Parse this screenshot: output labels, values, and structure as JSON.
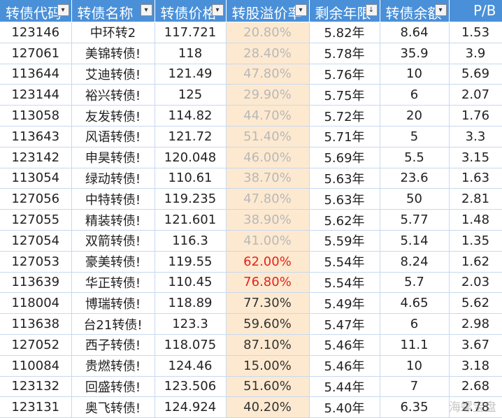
{
  "columns": [
    {
      "label": "转债代码",
      "filter": "dropdown"
    },
    {
      "label": "转债名称",
      "filter": "dropdown"
    },
    {
      "label": "转债价格",
      "filter": "filter-active"
    },
    {
      "label": "转股溢价率",
      "filter": "dropdown"
    },
    {
      "label": "剩余年限",
      "filter": "sorted-desc"
    },
    {
      "label": "转债余额",
      "filter": "dropdown"
    },
    {
      "label": "P/B",
      "filter": "dropdown"
    }
  ],
  "colors": {
    "header_bg": "#4a90d9",
    "premium_bg": "#fde9d0",
    "premium_faded": "#b8b8b8",
    "premium_highlight": "#e8201a",
    "premium_normal": "#333333"
  },
  "rows": [
    {
      "code": "123146",
      "name": "中环转2",
      "price": "117.721",
      "premium": "20.80%",
      "premium_style": "faded",
      "years": "5.82年",
      "balance": "8.64",
      "pb": "1.53"
    },
    {
      "code": "127061",
      "name": "美锦转债!",
      "price": "118",
      "premium": "28.40%",
      "premium_style": "faded",
      "years": "5.78年",
      "balance": "35.9",
      "pb": "3.9"
    },
    {
      "code": "113644",
      "name": "艾迪转债!",
      "price": "121.49",
      "premium": "47.80%",
      "premium_style": "faded",
      "years": "5.76年",
      "balance": "10",
      "pb": "5.69"
    },
    {
      "code": "123144",
      "name": "裕兴转债!",
      "price": "125",
      "premium": "29.90%",
      "premium_style": "faded",
      "years": "5.75年",
      "balance": "6",
      "pb": "2.07"
    },
    {
      "code": "113058",
      "name": "友发转债!",
      "price": "114.82",
      "premium": "44.70%",
      "premium_style": "faded",
      "years": "5.72年",
      "balance": "20",
      "pb": "1.76"
    },
    {
      "code": "113643",
      "name": "风语转债!",
      "price": "121.72",
      "premium": "51.40%",
      "premium_style": "faded",
      "years": "5.71年",
      "balance": "5",
      "pb": "3.3"
    },
    {
      "code": "123142",
      "name": "申昊转债!",
      "price": "120.048",
      "premium": "46.00%",
      "premium_style": "faded",
      "years": "5.69年",
      "balance": "5.5",
      "pb": "3.15"
    },
    {
      "code": "113054",
      "name": "绿动转债!",
      "price": "110.61",
      "premium": "38.70%",
      "premium_style": "faded",
      "years": "5.63年",
      "balance": "23.6",
      "pb": "1.63"
    },
    {
      "code": "127056",
      "name": "中特转债!",
      "price": "119.235",
      "premium": "47.80%",
      "premium_style": "faded",
      "years": "5.63年",
      "balance": "50",
      "pb": "2.81"
    },
    {
      "code": "127055",
      "name": "精装转债!",
      "price": "121.601",
      "premium": "38.90%",
      "premium_style": "faded",
      "years": "5.62年",
      "balance": "5.77",
      "pb": "1.48"
    },
    {
      "code": "127054",
      "name": "双箭转债!",
      "price": "116.3",
      "premium": "41.00%",
      "premium_style": "faded",
      "years": "5.59年",
      "balance": "5.14",
      "pb": "1.35"
    },
    {
      "code": "127053",
      "name": "豪美转债!",
      "price": "119.55",
      "premium": "62.00%",
      "premium_style": "highlight",
      "years": "5.54年",
      "balance": "8.24",
      "pb": "1.62"
    },
    {
      "code": "113639",
      "name": "华正转债!",
      "price": "110.45",
      "premium": "76.80%",
      "premium_style": "highlight",
      "years": "5.54年",
      "balance": "5.7",
      "pb": "2.03"
    },
    {
      "code": "118004",
      "name": "博瑞转债!",
      "price": "118.89",
      "premium": "77.30%",
      "premium_style": "normal",
      "years": "5.49年",
      "balance": "4.65",
      "pb": "5.62"
    },
    {
      "code": "113638",
      "name": "台21转债!",
      "price": "123.3",
      "premium": "59.60%",
      "premium_style": "normal",
      "years": "5.47年",
      "balance": "6",
      "pb": "2.98"
    },
    {
      "code": "127052",
      "name": "西子转债!",
      "price": "118.075",
      "premium": "87.10%",
      "premium_style": "normal",
      "years": "5.46年",
      "balance": "11.1",
      "pb": "3.67"
    },
    {
      "code": "110084",
      "name": "贵燃转债!",
      "price": "124.46",
      "premium": "15.00%",
      "premium_style": "normal",
      "years": "5.46年",
      "balance": "10",
      "pb": "3.18"
    },
    {
      "code": "123132",
      "name": "回盛转债!",
      "price": "123.506",
      "premium": "51.60%",
      "premium_style": "normal",
      "years": "5.44年",
      "balance": "7",
      "pb": "2.68"
    },
    {
      "code": "123131",
      "name": "奥飞转债!",
      "price": "124.924",
      "premium": "40.20%",
      "premium_style": "normal",
      "years": "5.40年",
      "balance": "6.35",
      "pb": "2.78"
    }
  ],
  "watermark": "海螺宝盘"
}
